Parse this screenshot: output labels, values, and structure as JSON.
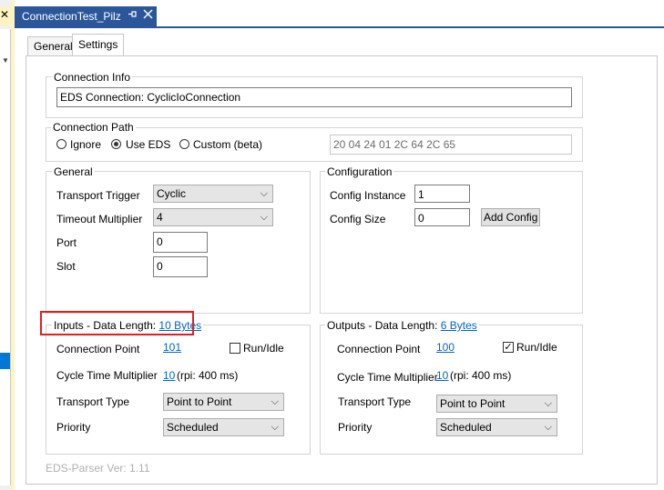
{
  "document": {
    "title": "ConnectionTest_Pilz",
    "pin_icon": "pin-icon",
    "close_icon": "close-icon",
    "left_panel_close": "✕"
  },
  "tabs": [
    {
      "label": "General",
      "selected": false
    },
    {
      "label": "Settings",
      "selected": true
    }
  ],
  "connection_info": {
    "legend": "Connection Info",
    "value": "EDS Connection: CyclicIoConnection"
  },
  "connection_path": {
    "legend": "Connection Path",
    "options": [
      {
        "label": "Ignore",
        "selected": false
      },
      {
        "label": "Use EDS",
        "selected": true
      },
      {
        "label": "Custom (beta)",
        "selected": false
      }
    ],
    "path_value": "20 04 24 01 2C 64 2C 65"
  },
  "general": {
    "legend": "General",
    "transport_trigger_label": "Transport Trigger",
    "transport_trigger_value": "Cyclic",
    "timeout_multiplier_label": "Timeout Multiplier",
    "timeout_multiplier_value": "4",
    "port_label": "Port",
    "port_value": "0",
    "slot_label": "Slot",
    "slot_value": "0"
  },
  "configuration": {
    "legend": "Configuration",
    "instance_label": "Config Instance",
    "instance_value": "1",
    "size_label": "Config Size",
    "size_value": "0",
    "add_button": "Add Config"
  },
  "inputs": {
    "legend_prefix": "Inputs - Data Length:",
    "legend_link": "10 Bytes",
    "connection_point_label": "Connection Point",
    "connection_point_value": "101",
    "run_idle_label": "Run/Idle",
    "run_idle_checked": false,
    "cycle_time_label": "Cycle Time Multiplier",
    "cycle_time_link": "10",
    "cycle_time_rpi": "(rpi: 400 ms)",
    "transport_type_label": "Transport Type",
    "transport_type_value": "Point to Point",
    "priority_label": "Priority",
    "priority_value": "Scheduled"
  },
  "outputs": {
    "legend_prefix": "Outputs - Data Length:",
    "legend_link": "6 Bytes",
    "connection_point_label": "Connection Point",
    "connection_point_value": "100",
    "run_idle_label": "Run/Idle",
    "run_idle_checked": true,
    "cycle_time_label": "Cycle Time Multiplier",
    "cycle_time_link": "10",
    "cycle_time_rpi": "(rpi: 400 ms)",
    "transport_type_label": "Transport Type",
    "transport_type_value": "Point to Point",
    "priority_label": "Priority",
    "priority_value": "Scheduled"
  },
  "footer": {
    "version": "EDS-Parser Ver: 1.11"
  },
  "colors": {
    "tab_header": "#2b579a",
    "highlight_border": "#e02020",
    "link": "#0066cc",
    "side_accent": "#fdf4bf"
  }
}
